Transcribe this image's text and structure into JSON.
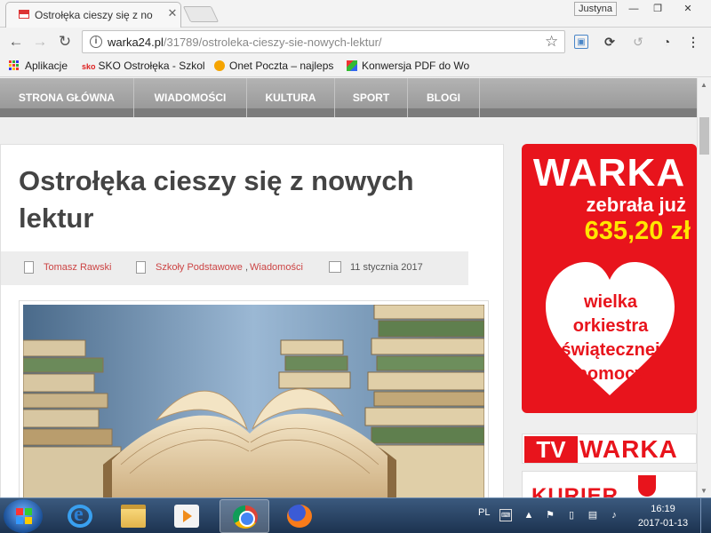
{
  "browser": {
    "tab_title": "Ostrołęka cieszy się z no",
    "profile_name": "Justyna",
    "url_domain": "warka24.pl",
    "url_path": "/31789/ostroleka-cieszy-sie-nowych-lektur/"
  },
  "bookmarks": [
    {
      "label": "Aplikacje"
    },
    {
      "label": "SKO Ostrołęka - Szkol",
      "icon_text": "sko"
    },
    {
      "label": "Onet Poczta – najleps"
    },
    {
      "label": "Konwersja PDF do Wo"
    }
  ],
  "nav": {
    "items": [
      "STRONA GŁÓWNA",
      "WIADOMOŚCI",
      "KULTURA",
      "SPORT",
      "BLOGI"
    ]
  },
  "article": {
    "title": "Ostrołęka cieszy się z nowych lektur",
    "author": "Tomasz Rawski",
    "category1": "Szkoły Podstawowe",
    "separator": ",",
    "category2": "Wiadomości",
    "date": "11 stycznia 2017"
  },
  "ad": {
    "line1": "WARKA",
    "line2": "zebrała już",
    "amount": "635,20 zł",
    "wosp": "wielka orkiestra świątecznej pomocy",
    "tv_left": "TV",
    "tv_right": "WARKA",
    "kurier": "KURIER"
  },
  "taskbar": {
    "lang": "PL",
    "time": "16:19",
    "date": "2017-01-13"
  },
  "colors": {
    "accent_red": "#e8141c",
    "link_red": "#cc4444",
    "ad_yellow": "#ffe600"
  }
}
